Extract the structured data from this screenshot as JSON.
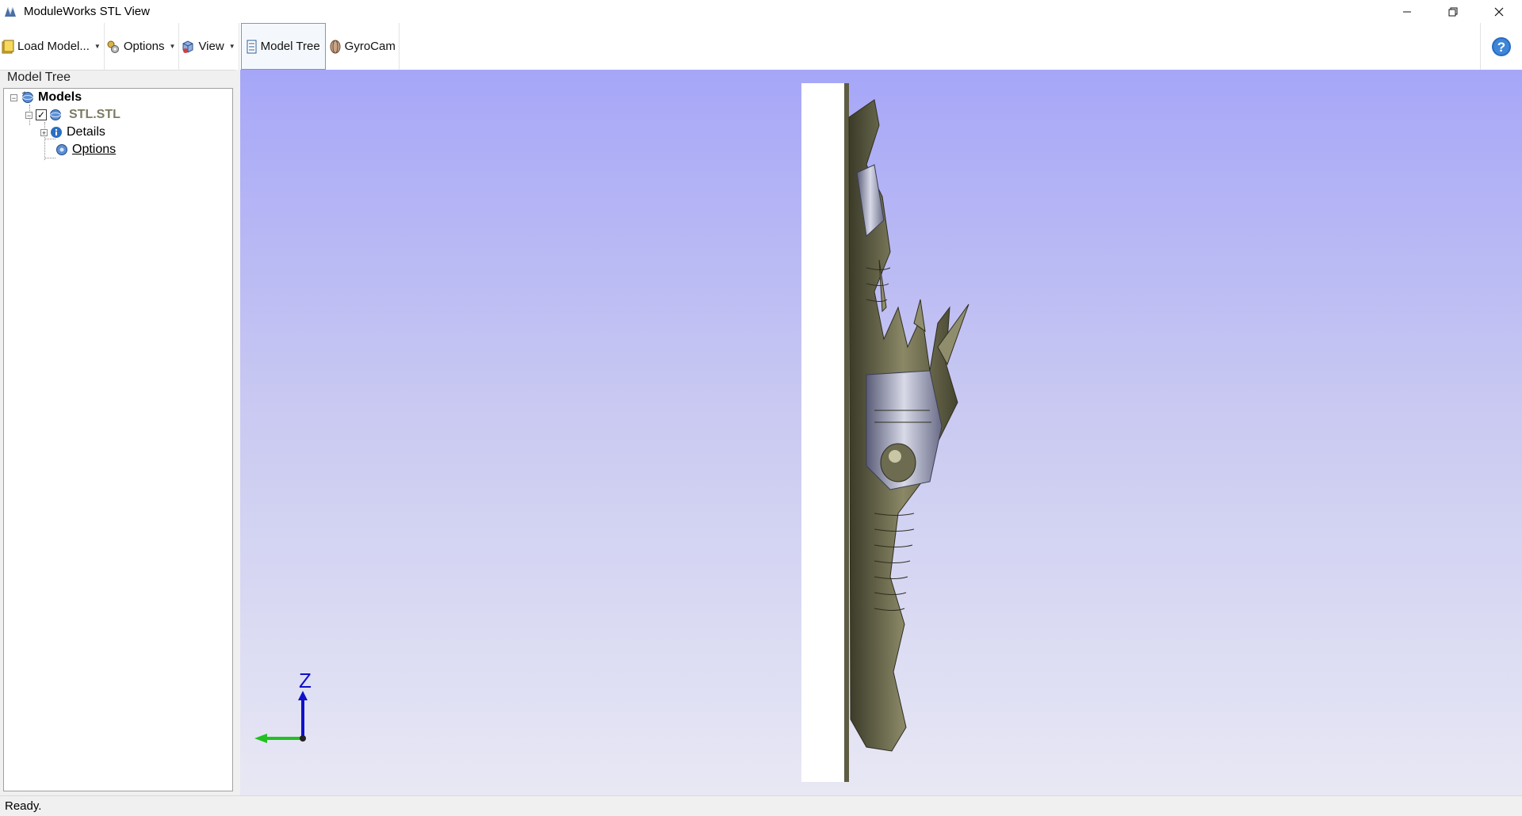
{
  "window": {
    "title": "ModuleWorks STL View",
    "controls": [
      "minimize-icon",
      "restore-icon",
      "close-icon"
    ]
  },
  "toolbar": {
    "items": [
      {
        "label": "Load Model...",
        "icon": "folder-icon",
        "dropdown": true
      },
      {
        "label": "Options",
        "icon": "gears-icon",
        "dropdown": true
      },
      {
        "label": "View",
        "icon": "cube-view-icon",
        "dropdown": true
      },
      {
        "label": "Model Tree",
        "icon": "tree-list-icon",
        "active": true
      },
      {
        "label": "GyroCam",
        "icon": "gyrocam-icon"
      }
    ],
    "help_icon": "help-icon"
  },
  "model_tree": {
    "panel_title": "Model Tree",
    "root": {
      "label": "Models",
      "expanded": true
    },
    "model": {
      "label": "STL.STL",
      "checked": true,
      "expanded": true
    },
    "children": [
      {
        "label": "Details",
        "icon": "info-icon",
        "expanded": false
      },
      {
        "label": "Options",
        "icon": "settings-icon"
      }
    ]
  },
  "viewport": {
    "axis_label": "Z",
    "axis_colors": {
      "z": "#1010c8",
      "y": "#22c020"
    },
    "background_top": "#a6a6f8",
    "background_bottom": "#e8e8f4",
    "model_color": "#6b6a4c"
  },
  "status": {
    "text": "Ready."
  }
}
